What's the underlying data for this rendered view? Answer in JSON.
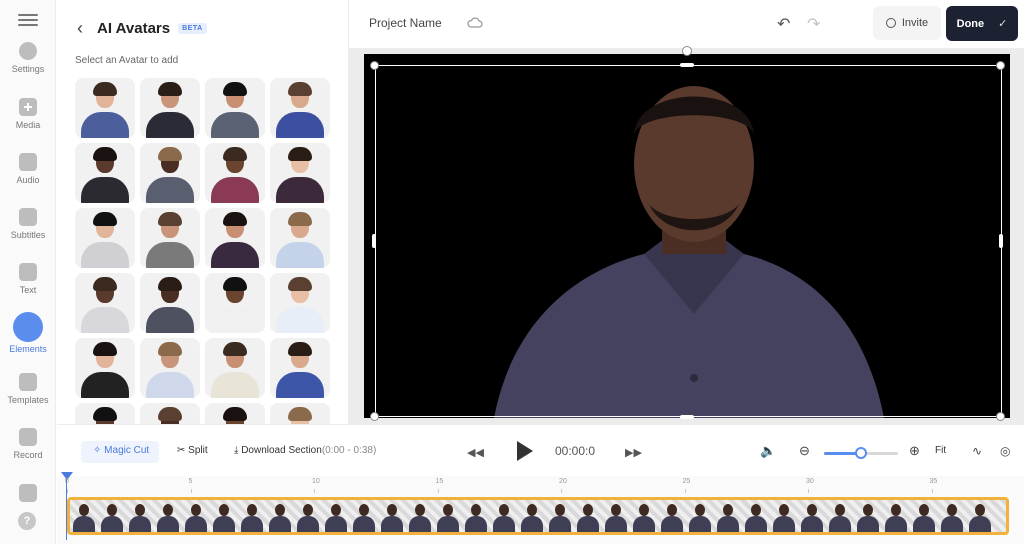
{
  "rail": {
    "items": [
      {
        "label": "Settings",
        "icon": "settings-icon"
      },
      {
        "label": "Media",
        "icon": "plus-icon"
      },
      {
        "label": "Audio",
        "icon": "music-icon"
      },
      {
        "label": "Subtitles",
        "icon": "subtitles-icon"
      },
      {
        "label": "Text",
        "icon": "text-icon"
      },
      {
        "label": "Elements",
        "icon": "elements-icon",
        "active": true
      },
      {
        "label": "Templates",
        "icon": "templates-icon"
      },
      {
        "label": "Record",
        "icon": "record-icon"
      }
    ],
    "help": "?"
  },
  "panel": {
    "title": "AI Avatars",
    "badge": "BETA",
    "subtitle": "Select an Avatar to add"
  },
  "topbar": {
    "project_name": "Project Name",
    "invite": "Invite",
    "done": "Done"
  },
  "controls": {
    "magic_cut": "Magic Cut",
    "split": "Split",
    "download_section": "Download Section",
    "download_range": "(0:00 - 0:38)",
    "time": "00:00:0",
    "fit": "Fit",
    "zoom_level": 0.5
  },
  "timeline": {
    "ticks": [
      "0",
      "5",
      "10",
      "15",
      "20",
      "25",
      "30",
      "35"
    ]
  },
  "colors": {
    "accent": "#5b8def",
    "done_bg": "#1d2233",
    "clip_border": "#f0b23c"
  }
}
